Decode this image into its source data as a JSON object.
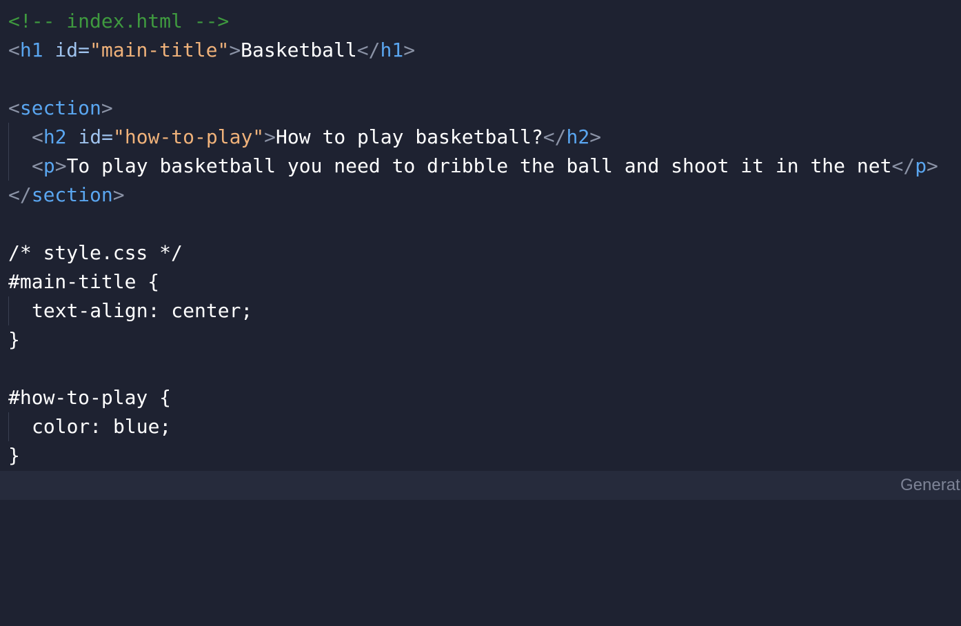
{
  "code": {
    "html_comment": "<!-- index.html -->",
    "h1": {
      "open_lt": "<",
      "tag": "h1",
      "attr": "id",
      "eq": "=",
      "value": "\"main-title\"",
      "open_gt": ">",
      "text": "Basketball",
      "close_lt": "</",
      "close_tag": "h1",
      "close_gt": ">"
    },
    "section_open": {
      "lt": "<",
      "tag": "section",
      "gt": ">"
    },
    "h2": {
      "open_lt": "<",
      "tag": "h2",
      "attr": "id",
      "eq": "=",
      "value": "\"how-to-play\"",
      "open_gt": ">",
      "text": "How to play basketball?",
      "close_lt": "</",
      "close_tag": "h2",
      "close_gt": ">"
    },
    "p": {
      "open_lt": "<",
      "tag": "p",
      "open_gt": ">",
      "text": "To play basketball you need to dribble the ball and shoot it in the net",
      "close_lt": "</",
      "close_tag": "p",
      "close_gt": ">"
    },
    "section_close": {
      "lt": "</",
      "tag": "section",
      "gt": ">"
    },
    "css_comment": "/* style.css */",
    "rule1_selector": "#main-title {",
    "rule1_decl": "text-align: center;",
    "rule1_close": "}",
    "rule2_selector": "#how-to-play {",
    "rule2_decl": "color: blue;",
    "rule2_close": "}"
  },
  "bottom_bar": {
    "label": "Generat"
  },
  "colors": {
    "background": "#1e2231",
    "comment": "#3f9a3f",
    "tag": "#5aa6f0",
    "attribute": "#9fc3ee",
    "string": "#f0b27a",
    "punctuation": "#8b93a6",
    "text": "#ffffff"
  }
}
